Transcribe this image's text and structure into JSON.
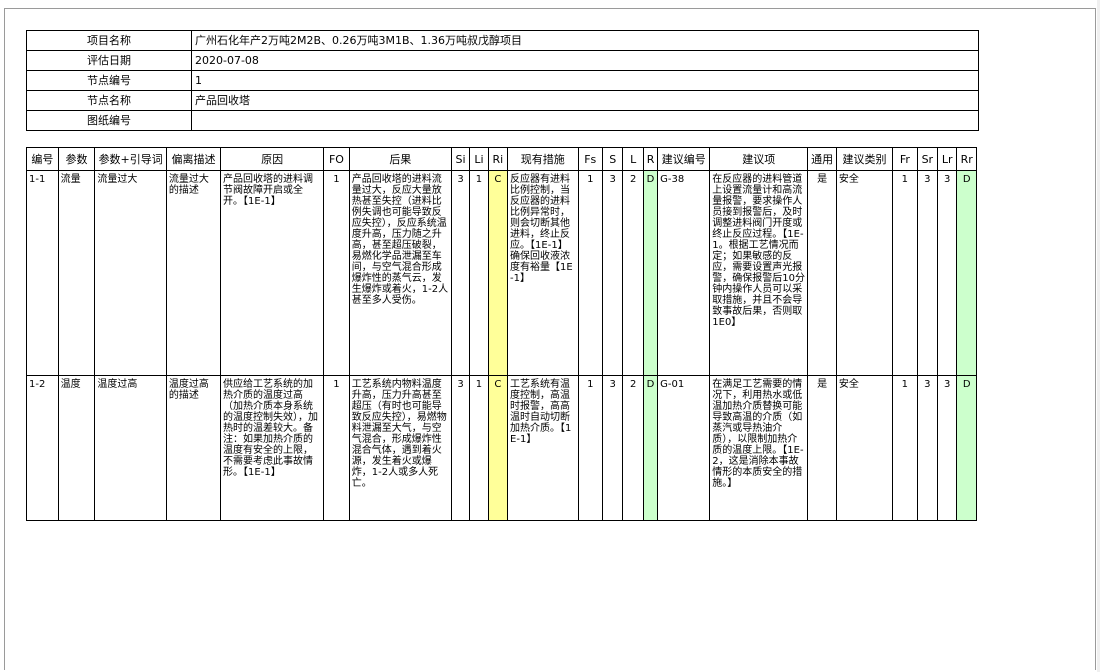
{
  "info": [
    {
      "label": "项目名称",
      "value": "广州石化年产2万吨2M2B、0.26万吨3M1B、1.36万吨叔戊醇项目"
    },
    {
      "label": "评估日期",
      "value": "2020-07-08"
    },
    {
      "label": "节点编号",
      "value": "1"
    },
    {
      "label": "节点名称",
      "value": "产品回收塔"
    },
    {
      "label": "图纸编号",
      "value": ""
    }
  ],
  "columns": [
    "编号",
    "参数",
    "参数+引导词",
    "偏离描述",
    "原因",
    "FO",
    "后果",
    "Si",
    "Li",
    "Ri",
    "现有措施",
    "Fs",
    "S",
    "L",
    "R",
    "建议编号",
    "建议项",
    "通用",
    "建议类别",
    "Fr",
    "Sr",
    "Lr",
    "Rr"
  ],
  "rows": [
    {
      "id": "1-1",
      "param": "流量",
      "param_guide": "流量过大",
      "deviation": "流量过大的描述",
      "cause": "产品回收塔的进料调节阀故障开启或全开。【1E-1】",
      "fo": "1",
      "consequence": "产品回收塔的进料流量过大，反应大量放热甚至失控（进料比例失调也可能导致反应失控），反应系统温度升高，压力随之升高，甚至超压破裂，易燃化学品泄漏至车间，与空气混合形成爆炸性的蒸气云，发生爆炸或着火，1-2人甚至多人受伤。",
      "si": "3",
      "li": "1",
      "ri": "C",
      "measures": "反应器有进料比例控制，当反应器的进料比例异常时，则会切断其他进料，终止反应。【1E-1】确保回收液浓度有裕量【1E-1】",
      "fs": "1",
      "s": "3",
      "l": "2",
      "r": "D",
      "rec_id": "G-38",
      "recommendation": "在反应器的进料管道上设置流量计和高流量报警，要求操作人员接到报警后，及时调整进料阀门开度或终止反应过程。【1E-1。根据工艺情况而定；如果敏感的反应，需要设置声光报警，确保报警后10分钟内操作人员可以采取措施，并且不会导致事故后果，否则取1E0】",
      "general": "是",
      "category": "安全",
      "fr": "1",
      "sr": "3",
      "lr": "3",
      "rr": "D"
    },
    {
      "id": "1-2",
      "param": "温度",
      "param_guide": "温度过高",
      "deviation": "温度过高的描述",
      "cause": "供应给工艺系统的加热介质的温度过高（加热介质本身系统的温度控制失效），加热时的温差较大。备注：如果加热介质的温度有安全的上限，不需要考虑此事故情形。【1E-1】",
      "fo": "1",
      "consequence": "工艺系统内物料温度升高，压力升高甚至超压（有时也可能导致反应失控），易燃物料泄漏至大气，与空气混合，形成爆炸性混合气体，遇到着火源，发生着火或爆炸，1-2人或多人死亡。",
      "si": "3",
      "li": "1",
      "ri": "C",
      "measures": "工艺系统有温度控制，高温时报警，高高温时自动切断加热介质。【1E-1】",
      "fs": "1",
      "s": "3",
      "l": "2",
      "r": "D",
      "rec_id": "G-01",
      "recommendation": "在满足工艺需要的情况下，利用热水或低温加热介质替换可能导致高温的介质（如蒸汽或导热油介质），以限制加热介质的温度上限。【1E-2，这是消除本事故情形的本质安全的措施。】",
      "general": "是",
      "category": "安全",
      "fr": "1",
      "sr": "3",
      "lr": "3",
      "rr": "D"
    }
  ]
}
